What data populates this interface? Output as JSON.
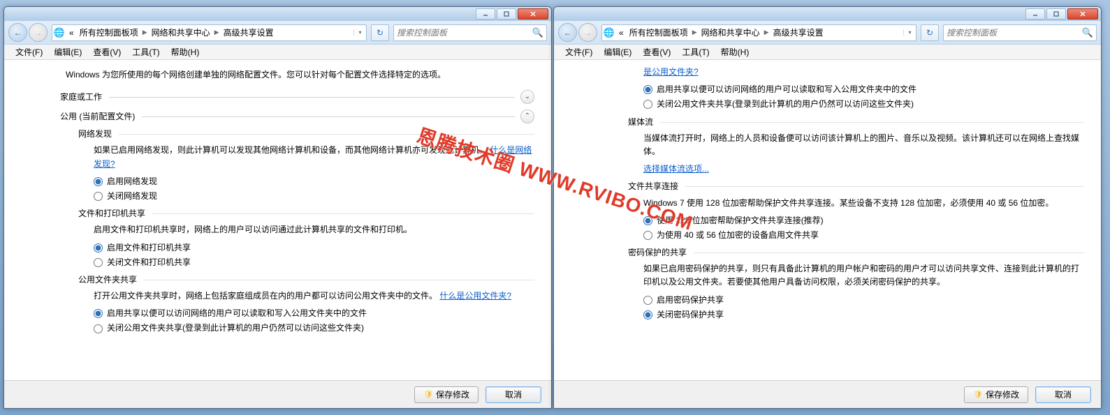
{
  "caption": {
    "min": "–",
    "max": "☐",
    "close": "✕"
  },
  "nav": {
    "back": "←",
    "fwd": "→",
    "globe": "🌐",
    "refresh": "↻",
    "searchIcon": "🔍"
  },
  "breadcrumbs": {
    "pre": "«",
    "b1": "所有控制面板项",
    "b2": "网络和共享中心",
    "b3": "高级共享设置",
    "drop": "▾"
  },
  "search": {
    "placeholder": "搜索控制面板"
  },
  "menu": {
    "file": "文件(F)",
    "edit": "编辑(E)",
    "view": "查看(V)",
    "tools": "工具(T)",
    "help": "帮助(H)"
  },
  "left": {
    "intro": "Windows 为您所使用的每个网络创建单独的网络配置文件。您可以针对每个配置文件选择特定的选项。",
    "group_home": "家庭或工作",
    "group_public": "公用 (当前配置文件)",
    "chev_down": "⌄",
    "chev_up": "⌃",
    "s1_title": "网络发现",
    "s1_desc": "如果已启用网络发现，则此计算机可以发现其他网络计算机和设备，而其他网络计算机亦可发现此计算机。",
    "s1_link": "什么是网络发现?",
    "s1_o1": "启用网络发现",
    "s1_o2": "关闭网络发现",
    "s2_title": "文件和打印机共享",
    "s2_desc": "启用文件和打印机共享时，网络上的用户可以访问通过此计算机共享的文件和打印机。",
    "s2_o1": "启用文件和打印机共享",
    "s2_o2": "关闭文件和打印机共享",
    "s3_title": "公用文件夹共享",
    "s3_desc": "打开公用文件夹共享时，网络上包括家庭组成员在内的用户都可以访问公用文件夹中的文件。",
    "s3_link": "什么是公用文件夹?",
    "s3_o1": "启用共享以便可以访问网络的用户可以读取和写入公用文件夹中的文件",
    "s3_o2": "关闭公用文件夹共享(登录到此计算机的用户仍然可以访问这些文件夹)"
  },
  "right": {
    "top_link": "是公用文件夹?",
    "pf_o1": "启用共享以便可以访问网络的用户可以读取和写入公用文件夹中的文件",
    "pf_o2": "关闭公用文件夹共享(登录到此计算机的用户仍然可以访问这些文件夹)",
    "s1_title": "媒体流",
    "s1_desc": "当媒体流打开时，网络上的人员和设备便可以访问该计算机上的图片、音乐以及视频。该计算机还可以在网络上查找媒体。",
    "s1_link": "选择媒体流选项...",
    "s2_title": "文件共享连接",
    "s2_desc": "Windows 7 使用 128 位加密帮助保护文件共享连接。某些设备不支持 128 位加密，必须使用 40 或 56 位加密。",
    "s2_o1": "使用 128 位加密帮助保护文件共享连接(推荐)",
    "s2_o2": "为使用 40 或 56 位加密的设备启用文件共享",
    "s3_title": "密码保护的共享",
    "s3_desc": "如果已启用密码保护的共享，则只有具备此计算机的用户帐户和密码的用户才可以访问共享文件、连接到此计算机的打印机以及公用文件夹。若要使其他用户具备访问权限，必须关闭密码保护的共享。",
    "s3_o1": "启用密码保护共享",
    "s3_o2": "关闭密码保护共享"
  },
  "footer": {
    "save": "保存修改",
    "cancel": "取消",
    "shield": "🛡"
  },
  "watermark": "恩腾技术圈 WWW.RVIBO.COM"
}
